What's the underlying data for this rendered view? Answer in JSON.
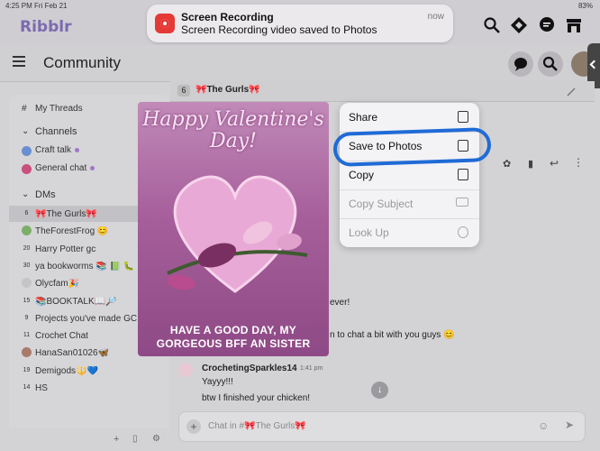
{
  "status": {
    "time": "4:25 PM",
    "date": "Fri Feb 21",
    "battery": "83%"
  },
  "app": {
    "brand": "Ribblr",
    "page_title": "Community"
  },
  "notification": {
    "title": "Screen Recording",
    "body": "Screen Recording video saved to Photos",
    "time": "now"
  },
  "sidebar": {
    "my_threads": "My Threads",
    "channels_header": "Channels",
    "channels": [
      "Craft talk",
      "General chat"
    ],
    "dms_header": "DMs",
    "dms": [
      {
        "badge": "6",
        "label": "🎀The Gurls🎀"
      },
      {
        "badge": "",
        "label": "TheForestFrog 😊"
      },
      {
        "badge": "20",
        "label": "Harry Potter gc"
      },
      {
        "badge": "30",
        "label": "ya bookworms 📚 📗 🐛"
      },
      {
        "badge": "",
        "label": "Olycfam🎉"
      },
      {
        "badge": "15",
        "label": "📚BOOKTALK📖🔎"
      },
      {
        "badge": "9",
        "label": "Projects you've made GC"
      },
      {
        "badge": "11",
        "label": "Crochet Chat"
      },
      {
        "badge": "",
        "label": "HanaSan01026🦋"
      },
      {
        "badge": "19",
        "label": "Demigods🔱💙"
      },
      {
        "badge": "14",
        "label": "HS"
      }
    ]
  },
  "chat": {
    "header_count": "6",
    "header_title": "🎀The Gurls🎀",
    "messages": [
      {
        "text": "ever!"
      },
      {
        "text": "n to chat a bit with you guys 😊"
      }
    ],
    "author": "CrochetingSparkles14",
    "author_time": "1:41 pm",
    "post_lines": [
      "Yayyy!!!",
      "btw I finished your chicken!"
    ],
    "composer_placeholder": "Chat in #🎀The Gurls🎀"
  },
  "image": {
    "heading": "Happy Valentine's Day!",
    "footer_line1": "HAVE A GOOD DAY, MY",
    "footer_line2": "GORGEOUS BFF AN SISTER"
  },
  "context_menu": {
    "items": [
      {
        "label": "Share",
        "icon": "share-icon",
        "enabled": true
      },
      {
        "label": "Save to Photos",
        "icon": "save-photos-icon",
        "enabled": true
      },
      {
        "label": "Copy",
        "icon": "copy-icon",
        "enabled": true
      },
      {
        "label": "Copy Subject",
        "icon": "copy-subject-icon",
        "enabled": false
      },
      {
        "label": "Look Up",
        "icon": "lookup-icon",
        "enabled": false
      }
    ]
  },
  "colors": {
    "brand": "#7b6bb0",
    "highlight_circle": "#1f6bd6",
    "notification_icon": "#e53935"
  }
}
